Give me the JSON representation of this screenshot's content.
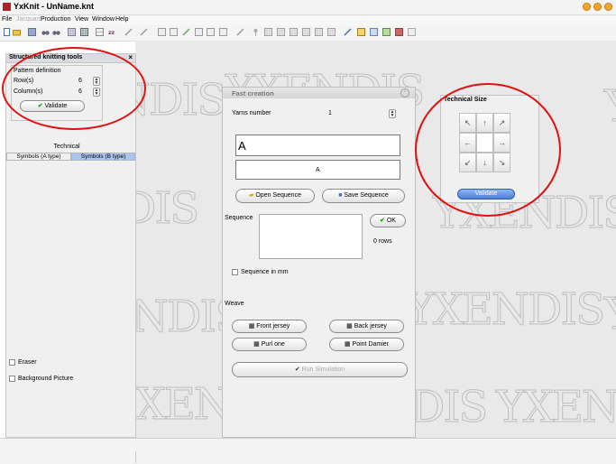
{
  "window": {
    "title": "YxKnit - UnName.knt"
  },
  "menu": {
    "items": [
      "File",
      "Jacquard",
      "Production",
      "View",
      "Window",
      "Help"
    ]
  },
  "toolbar": {
    "icons": [
      "new-file-icon",
      "open-folder-icon",
      "save-icon",
      "binoculars-icon",
      "binoculars-icon",
      "grid-icon",
      "grid-icon",
      "grid-icon",
      "zz-icon",
      "pen-icon",
      "pen-icon",
      "grid-icon",
      "grid-icon",
      "tool-icon",
      "grid-icon",
      "grid-icon",
      "grid-icon",
      "pen-icon",
      "pin-icon",
      "grid-icon",
      "grid-icon",
      "grid-icon",
      "grid-icon",
      "grid-icon",
      "pencil-icon",
      "grid-icon",
      "grid-icon",
      "grid-icon",
      "grid-icon",
      "grid-icon"
    ]
  },
  "left_panel": {
    "title": "Structured knitting tools",
    "close": "×",
    "pattern_definition": {
      "legend": "Pattern definition",
      "rows_label": "Row(s)",
      "rows_value": "6",
      "columns_label": "Column(s)",
      "columns_value": "6",
      "validate_label": "Validate"
    },
    "technical_label": "Technical",
    "tabs": [
      "Symbols (A type)",
      "Symbols (B type)"
    ],
    "active_tab": "Symbols (B type)",
    "eraser_label": "Eraser",
    "background_picture_label": "Background Picture"
  },
  "watermark": {
    "text": "YXENDIS"
  },
  "fast_creation": {
    "title": "Fast creation",
    "yarns_number_label": "Yarns number",
    "yarns_number_value": "1",
    "big_text": "A",
    "small_text": "A",
    "open_sequence_label": "Open Sequence",
    "save_sequence_label": "Save Sequence",
    "sequence_label": "Sequence",
    "ok_label": "OK",
    "rows_count": "0 rows",
    "sequence_in_mm_label": "Sequence in mm",
    "weave_label": "Weave",
    "front_jersey_label": "Front jersey",
    "back_jersey_label": "Back jersey",
    "purl_one_label": "Purl one",
    "point_damier_label": "Point Damier",
    "run_simulation_label": "Run Simulation"
  },
  "technical_size": {
    "title": "Technical Size",
    "arrows": [
      "↖",
      "↑",
      "↗",
      "←",
      "",
      "→",
      "↙",
      "↓",
      "↘"
    ],
    "validate_label": "Validate"
  },
  "colors": {
    "annotation": "#e01010",
    "accent": "#4d7fd6",
    "active_tab": "#a9c4ef"
  }
}
